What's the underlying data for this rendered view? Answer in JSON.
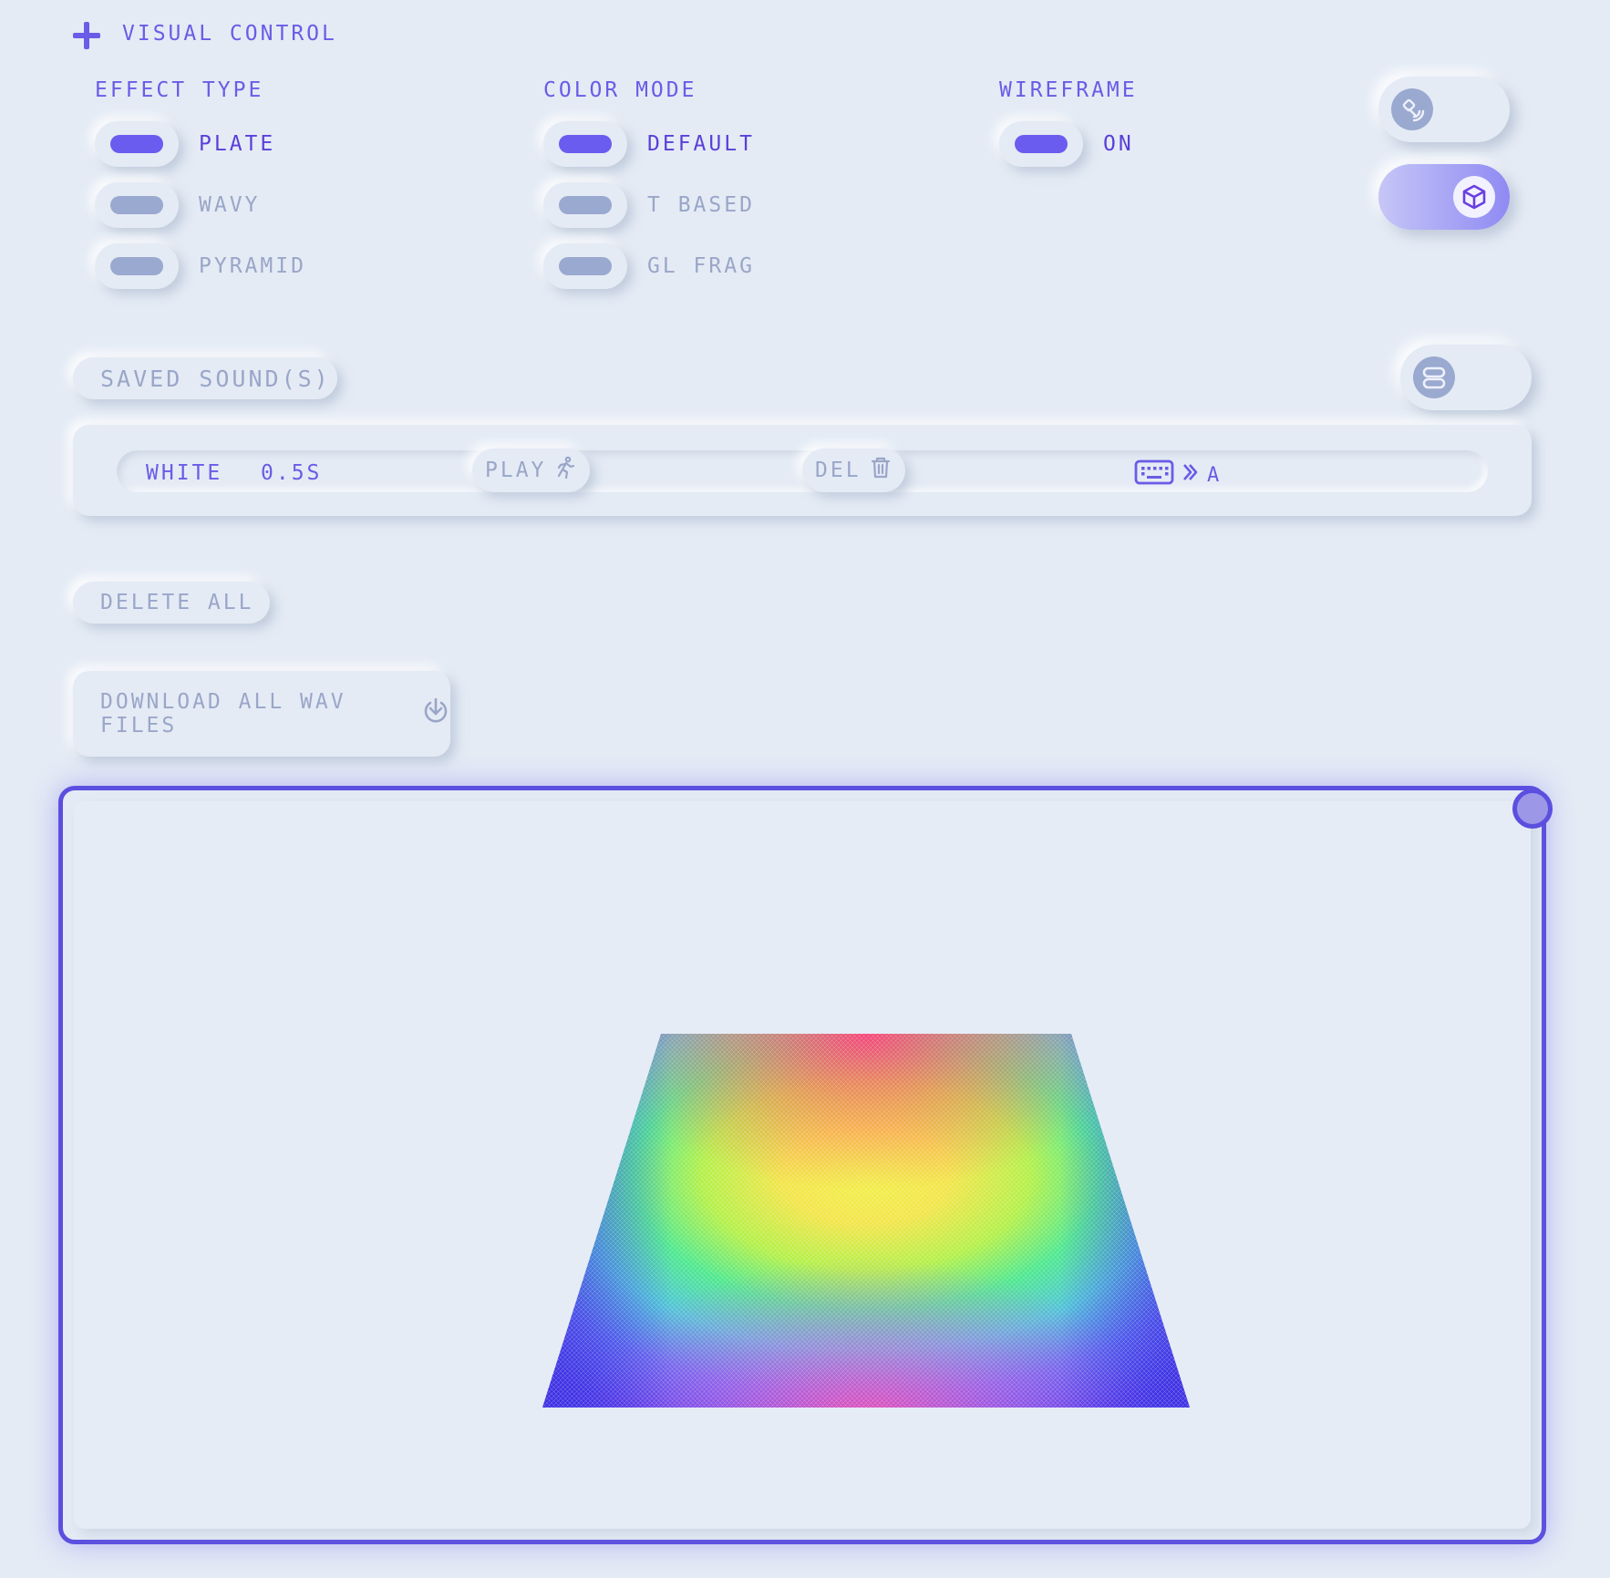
{
  "header": {
    "title": "VISUAL CONTROL"
  },
  "groups": [
    {
      "title": "EFFECT TYPE",
      "options": [
        {
          "label": "PLATE",
          "on": true
        },
        {
          "label": "WAVY",
          "on": false
        },
        {
          "label": "PYRAMID",
          "on": false
        }
      ]
    },
    {
      "title": "COLOR MODE",
      "options": [
        {
          "label": "DEFAULT",
          "on": true
        },
        {
          "label": "T BASED",
          "on": false
        },
        {
          "label": "GL FRAG",
          "on": false
        }
      ]
    },
    {
      "title": "WIREFRAME",
      "options": [
        {
          "label": "ON",
          "on": true
        }
      ]
    }
  ],
  "side_toggles": [
    {
      "icon": "satellite-icon",
      "active": false
    },
    {
      "icon": "cube-icon",
      "active": true
    }
  ],
  "saved": {
    "label": "SAVED SOUND(S)",
    "layout_icon": "stack-icon",
    "items": [
      {
        "name": "WHITE",
        "duration": "0.5S",
        "play_label": "PLAY",
        "delete_label": "DEL",
        "key_label": "A"
      }
    ]
  },
  "actions": {
    "delete_all": "DELETE ALL",
    "download_all": "DOWNLOAD ALL WAV FILES"
  },
  "colors": {
    "accent": "#6b5cf0",
    "frame": "#5b4fe0",
    "background": "#e4ebf5",
    "muted": "#9aa6c8"
  }
}
